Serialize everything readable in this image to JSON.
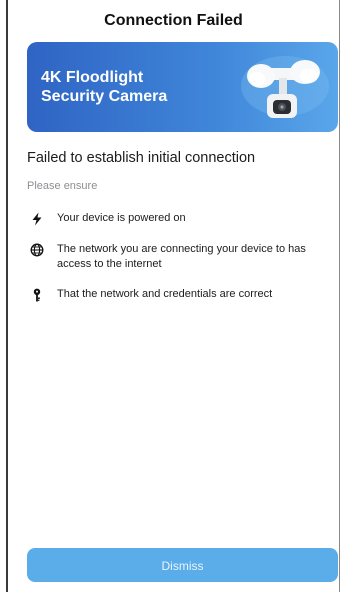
{
  "header": {
    "title": "Connection Failed"
  },
  "banner": {
    "product_line1": "4K Floodlight",
    "product_line2": "Security Camera",
    "image_icon": "floodlight-camera-image"
  },
  "main": {
    "heading": "Failed to establish initial connection",
    "subheading": "Please ensure",
    "checklist": [
      {
        "icon": "lightning-icon",
        "text": "Your device is powered on"
      },
      {
        "icon": "globe-icon",
        "text": "The network you are connecting your device to has access to the internet"
      },
      {
        "icon": "key-icon",
        "text": "That the network and credentials are correct"
      }
    ]
  },
  "footer": {
    "dismiss_label": "Dismiss"
  },
  "colors": {
    "banner_start": "#2f64c4",
    "banner_end": "#5aa6ea",
    "button": "#5aade9",
    "muted_text": "#8e8e93"
  }
}
